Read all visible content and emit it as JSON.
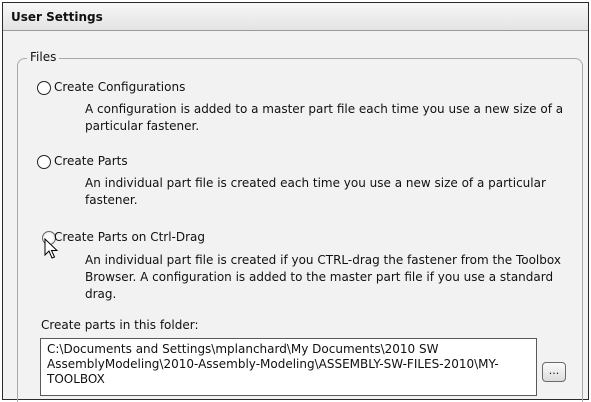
{
  "header": {
    "title": "User Settings"
  },
  "group": {
    "legend": "Files"
  },
  "options": [
    {
      "label": "Create Configurations",
      "description": "A configuration is added to a master part file each time you use a new size of a particular fastener."
    },
    {
      "label": "Create Parts",
      "description": "An individual part file is created each time you use a new size of a particular fastener."
    },
    {
      "label": "Create Parts on Ctrl-Drag",
      "description": "An individual part file is created if you CTRL-drag the fastener from the Toolbox Browser. A configuration is added to the master part file if you use a standard drag."
    }
  ],
  "folder": {
    "label": "Create parts in this folder:",
    "path": "C:\\Documents and Settings\\mplanchard\\My Documents\\2010 SW AssemblyModeling\\2010-Assembly-Modeling\\ASSEMBLY-SW-FILES-2010\\MY-TOOLBOX",
    "browse_label": "..."
  },
  "icons": {
    "radio": "radio-button-icon",
    "cursor": "mouse-pointer-icon"
  }
}
